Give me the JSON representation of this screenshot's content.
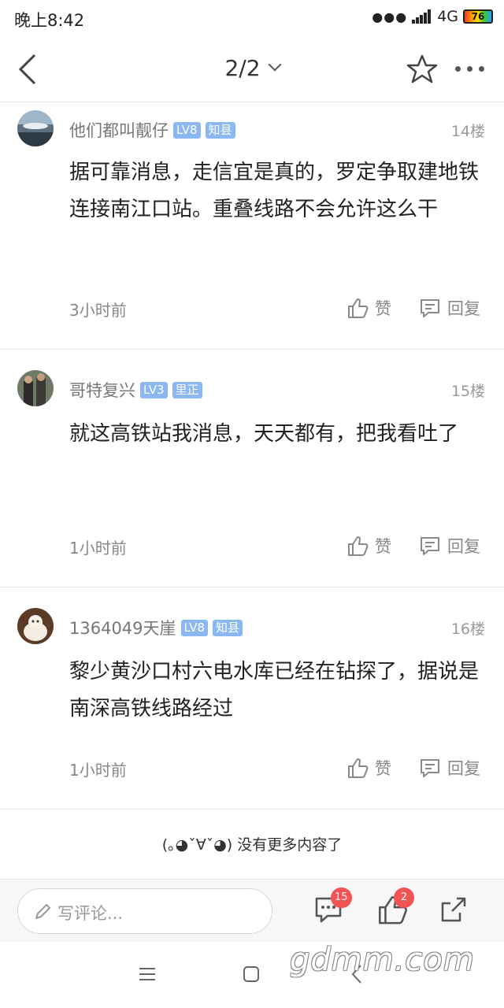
{
  "status": {
    "time": "晚上8:42",
    "network": "4G",
    "battery": "76"
  },
  "nav": {
    "pager": "2/2"
  },
  "comments": [
    {
      "user": "他们都叫靓仔",
      "level": "LV8",
      "title": "知县",
      "floor": "14楼",
      "text": "据可靠消息，走信宜是真的，罗定争取建地铁连接南江口站。重叠线路不会允许这么干",
      "time": "3小时前",
      "like_label": "赞",
      "reply_label": "回复"
    },
    {
      "user": "哥特复兴",
      "level": "LV3",
      "title": "里正",
      "floor": "15楼",
      "text": "就这高铁站我消息，天天都有，把我看吐了",
      "time": "1小时前",
      "like_label": "赞",
      "reply_label": "回复"
    },
    {
      "user": "1364049天崖",
      "level": "LV8",
      "title": "知县",
      "floor": "16楼",
      "text": "黎少黄沙口村六电水库已经在钻探了，据说是南深高铁线路经过",
      "time": "1小时前",
      "like_label": "赞",
      "reply_label": "回复"
    }
  ],
  "end_message": "(｡◕ˇ∀ˇ◕) 没有更多内容了",
  "bottom": {
    "input_placeholder": "写评论...",
    "comment_count": "15",
    "like_count": "2"
  },
  "watermark": "gdmm.com",
  "colors": {
    "badge": "#8cb8f2",
    "red_badge": "#f25353"
  }
}
